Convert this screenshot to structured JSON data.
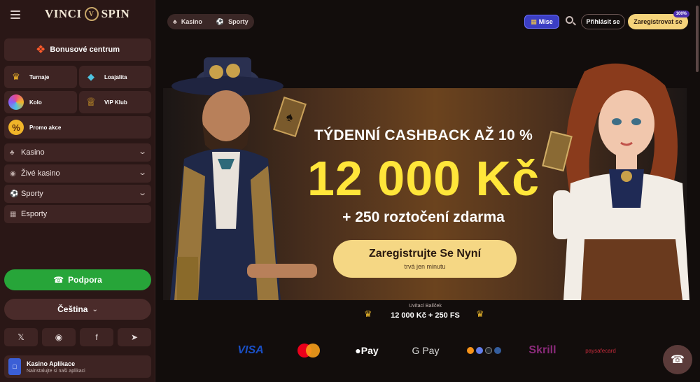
{
  "brand": {
    "logo_left": "VINCI",
    "logo_mark": "V",
    "logo_right": "SPIN"
  },
  "sidebar": {
    "bonus_center": "Bonusové centrum",
    "tiles": [
      {
        "label": "Turnaje",
        "icon": "trophy-icon"
      },
      {
        "label": "Loajalita",
        "icon": "loyalty-diamond-icon"
      },
      {
        "label": "Kolo",
        "icon": "wheel-icon"
      },
      {
        "label": "VIP Klub",
        "icon": "crown-icon"
      },
      {
        "label": "Promo akce",
        "icon": "percent-icon"
      }
    ],
    "nav": [
      {
        "label": "Kasino",
        "icon": "cherries-icon",
        "expandable": true
      },
      {
        "label": "Živé kasino",
        "icon": "broadcast-icon",
        "expandable": true
      },
      {
        "label": "Sporty",
        "icon": "football-icon",
        "expandable": true
      },
      {
        "label": "Esporty",
        "icon": "gamepad-icon",
        "expandable": false
      }
    ],
    "support_label": "Podpora",
    "language_label": "Čeština",
    "socials": [
      "x-icon",
      "instagram-icon",
      "facebook-icon",
      "telegram-icon"
    ],
    "app_title": "Kasino Aplikace",
    "app_subtitle": "Nainstalujte si naši aplikaci"
  },
  "topbar": {
    "tab_casino": "Kasino",
    "tab_sports": "Sporty",
    "missions": "Mise",
    "login": "Přihlásit se",
    "register": "Zaregistrovat se",
    "register_badge": "100%"
  },
  "hero": {
    "title": "TÝDENNÍ CASHBACK AŽ 10 %",
    "amount": "12 000 Kč",
    "spins": "+ 250 roztočení zdarma",
    "cta": "Zaregistrujte Se Nyní",
    "cta_sub": "trvá jen minutu"
  },
  "welcome": {
    "label": "Uvítací Balíček",
    "value": "12 000 Kč + 250 FS"
  },
  "payments": [
    "VISA",
    "Pay",
    "G Pay",
    "Skrill",
    "paysafecard"
  ],
  "colors": {
    "accent_yellow": "#ffe63a",
    "cta": "#f5d784",
    "support_green": "#27a539",
    "missions_blue": "#3b3ec4"
  }
}
